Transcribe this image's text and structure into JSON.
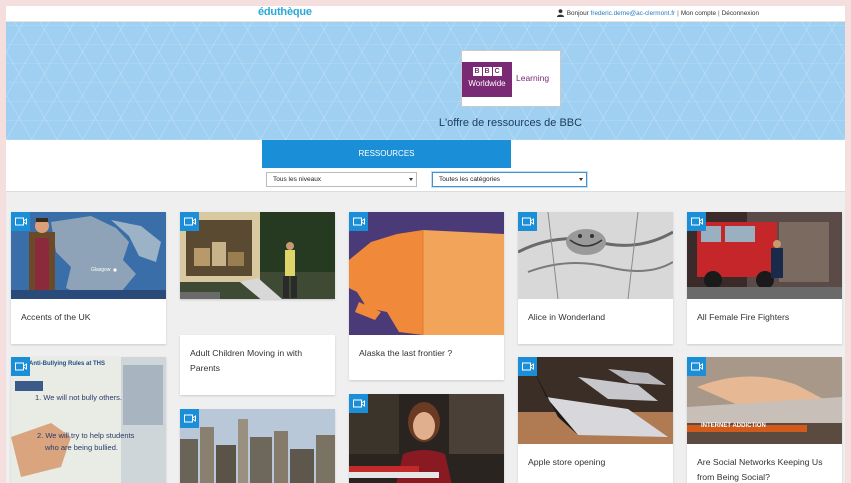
{
  "header": {
    "logo": "éduthèque",
    "greeting": "Bonjour",
    "user_email": "frederic.deme@ac-clermont.fr",
    "separator": "|",
    "account_link": "Mon compte",
    "logout_link": "Déconnexion"
  },
  "hero": {
    "partner_logo_brand": "BBC Worldwide",
    "partner_logo_letters": [
      "B",
      "B",
      "C"
    ],
    "partner_logo_worldwide": "Worldwide",
    "partner_logo_learning": "Learning",
    "title": "L'offre de ressources de BBC"
  },
  "tabs": {
    "active_label": "RESSOURCES"
  },
  "filters": {
    "level_selected": "Tous les niveaux",
    "category_selected": "Toutes les catégories"
  },
  "colors": {
    "accent": "#1a8fd8",
    "bbc_purple": "#7a2a74",
    "hero_bg": "#9fd0f2"
  },
  "cards": [
    {
      "title": "Accents of the UK",
      "icon": "video-icon"
    },
    {
      "title": "Adult Children Moving in with Parents",
      "icon": "video-icon"
    },
    {
      "title": "Alaska the last frontier ?",
      "icon": "video-icon"
    },
    {
      "title": "Alice in Wonderland",
      "icon": "video-icon"
    },
    {
      "title": "All Female Fire Fighters",
      "icon": "video-icon"
    },
    {
      "title": "",
      "icon": "video-icon"
    },
    {
      "title": "",
      "icon": "video-icon"
    },
    {
      "title": "",
      "icon": "video-icon"
    },
    {
      "title": "Apple store opening",
      "icon": "video-icon"
    },
    {
      "title": "Are Social Networks Keeping Us from Being Social?",
      "icon": "video-icon"
    }
  ],
  "thumb_text": {
    "glasgow": "Glasgow",
    "bullying_header": "Anti-Bullying Rules at THS",
    "bullying_line1": "1. We will not bully others.",
    "bullying_line2": "2. We will try to help students",
    "bullying_line3": "who are being bullied.",
    "internet_addiction": "INTERNET ADDICTION"
  }
}
